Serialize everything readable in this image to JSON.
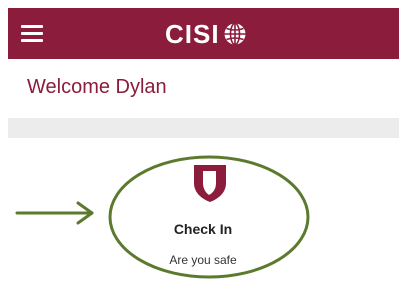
{
  "header": {
    "brand": "CISI",
    "menu_icon": "hamburger-menu-icon",
    "logo_icon": "globe-icon",
    "background": "#8b1c3c"
  },
  "main": {
    "welcome": "Welcome Dylan",
    "check_in": {
      "icon": "shield-icon",
      "title": "Check In",
      "subtitle": "Are you safe"
    }
  },
  "annotation": {
    "color": "#5c7a2e"
  }
}
